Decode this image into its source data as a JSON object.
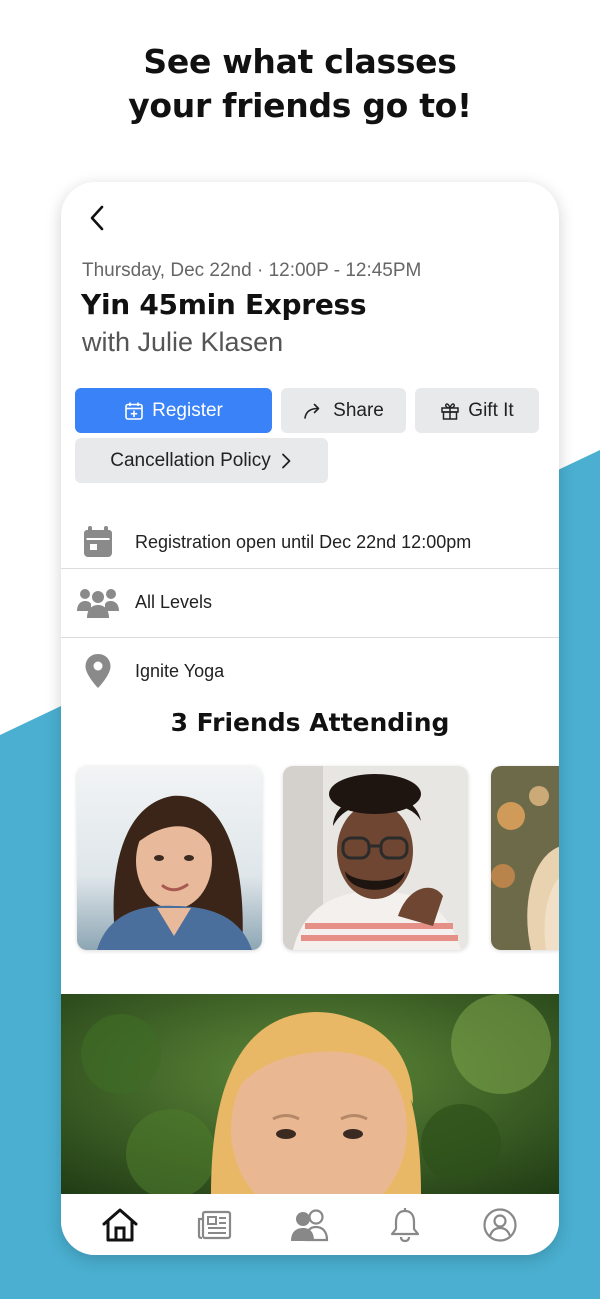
{
  "promo": {
    "headline_line1": "See what classes",
    "headline_line2": "your friends go to!"
  },
  "colors": {
    "accent": "#3a82f7",
    "wedge": "#4aafd0",
    "button_gray": "#e8e9eb"
  },
  "class": {
    "date_time": "Thursday, Dec 22nd · 12:00P - 12:45PM",
    "title": "Yin 45min Express",
    "instructor": "with Julie Klasen"
  },
  "actions": {
    "register_label": "Register",
    "share_label": "Share",
    "gift_label": "Gift It",
    "policy_label": "Cancellation Policy"
  },
  "info": {
    "registration": "Registration open until Dec 22nd 12:00pm",
    "level": "All Levels",
    "location": "Ignite Yoga"
  },
  "friends": {
    "heading": "3 Friends Attending"
  },
  "icons": {
    "back": "chevron-left-icon",
    "register": "calendar-plus-icon",
    "share": "share-arrow-icon",
    "gift": "gift-icon",
    "policy": "chevron-right-icon",
    "registration": "calendar-icon",
    "level": "group-icon",
    "location": "map-pin-icon",
    "tabs": [
      "home-icon",
      "news-icon",
      "friends-icon",
      "bell-icon",
      "profile-icon"
    ]
  },
  "tabbar": {
    "active": "home"
  }
}
